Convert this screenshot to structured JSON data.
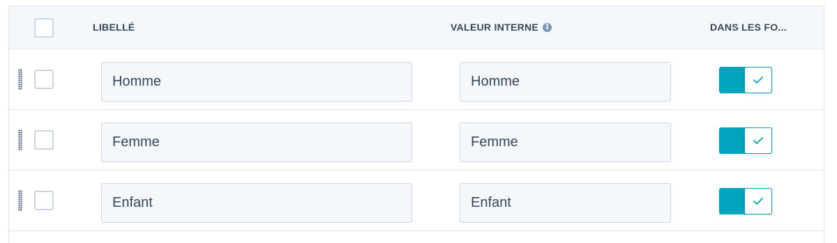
{
  "header": {
    "label_col": "LIBELLÉ",
    "internal_col": "VALEUR INTERNE",
    "form_col": "DANS LES FO...",
    "info_icon": "info-icon"
  },
  "rows": [
    {
      "label": "Homme",
      "internal": "Homme",
      "in_forms": true
    },
    {
      "label": "Femme",
      "internal": "Femme",
      "in_forms": true
    },
    {
      "label": "Enfant",
      "internal": "Enfant",
      "in_forms": true
    }
  ],
  "colors": {
    "toggle_on": "#00a4bd",
    "header_bg": "#f5f8fa",
    "border": "#dfe3eb",
    "text": "#33475b"
  }
}
